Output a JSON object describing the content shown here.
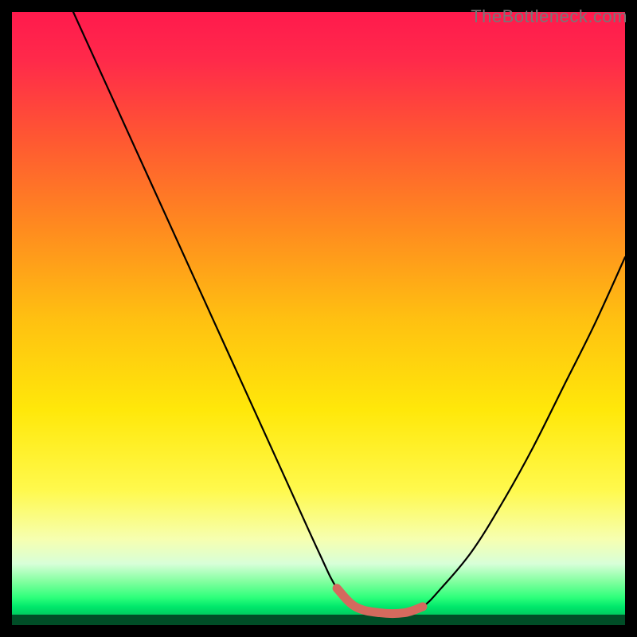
{
  "watermark": "TheBottleneck.com",
  "chart_data": {
    "type": "line",
    "title": "",
    "xlabel": "",
    "ylabel": "",
    "xlim": [
      0,
      100
    ],
    "ylim": [
      0,
      100
    ],
    "grid": false,
    "legend": false,
    "series": [
      {
        "name": "curve",
        "x": [
          10,
          15,
          20,
          25,
          30,
          35,
          40,
          45,
          50,
          53,
          56,
          60,
          64,
          67,
          70,
          75,
          80,
          85,
          90,
          95,
          100
        ],
        "y": [
          100,
          89,
          78,
          67,
          56,
          45,
          34,
          23,
          12,
          6,
          3,
          2,
          2,
          3,
          6,
          12,
          20,
          29,
          39,
          49,
          60
        ]
      },
      {
        "name": "highlight",
        "x": [
          53,
          56,
          60,
          64,
          67
        ],
        "y": [
          6,
          3,
          2,
          2,
          3
        ]
      }
    ],
    "gradient_stops": [
      {
        "offset": 0.0,
        "color": "#ff1a4d"
      },
      {
        "offset": 0.08,
        "color": "#ff2a4a"
      },
      {
        "offset": 0.2,
        "color": "#ff5533"
      },
      {
        "offset": 0.35,
        "color": "#ff8a1f"
      },
      {
        "offset": 0.5,
        "color": "#ffc011"
      },
      {
        "offset": 0.65,
        "color": "#ffe80a"
      },
      {
        "offset": 0.78,
        "color": "#fff94d"
      },
      {
        "offset": 0.86,
        "color": "#f6ffb0"
      },
      {
        "offset": 0.9,
        "color": "#d8ffd8"
      },
      {
        "offset": 0.93,
        "color": "#7fff9e"
      },
      {
        "offset": 0.955,
        "color": "#2eff7b"
      },
      {
        "offset": 0.97,
        "color": "#00e86b"
      },
      {
        "offset": 0.985,
        "color": "#00c85e"
      },
      {
        "offset": 1.0,
        "color": "#009944"
      }
    ],
    "dark_band_y": 98.3,
    "highlight_color": "#d46a5e",
    "curve_color": "#000000"
  }
}
